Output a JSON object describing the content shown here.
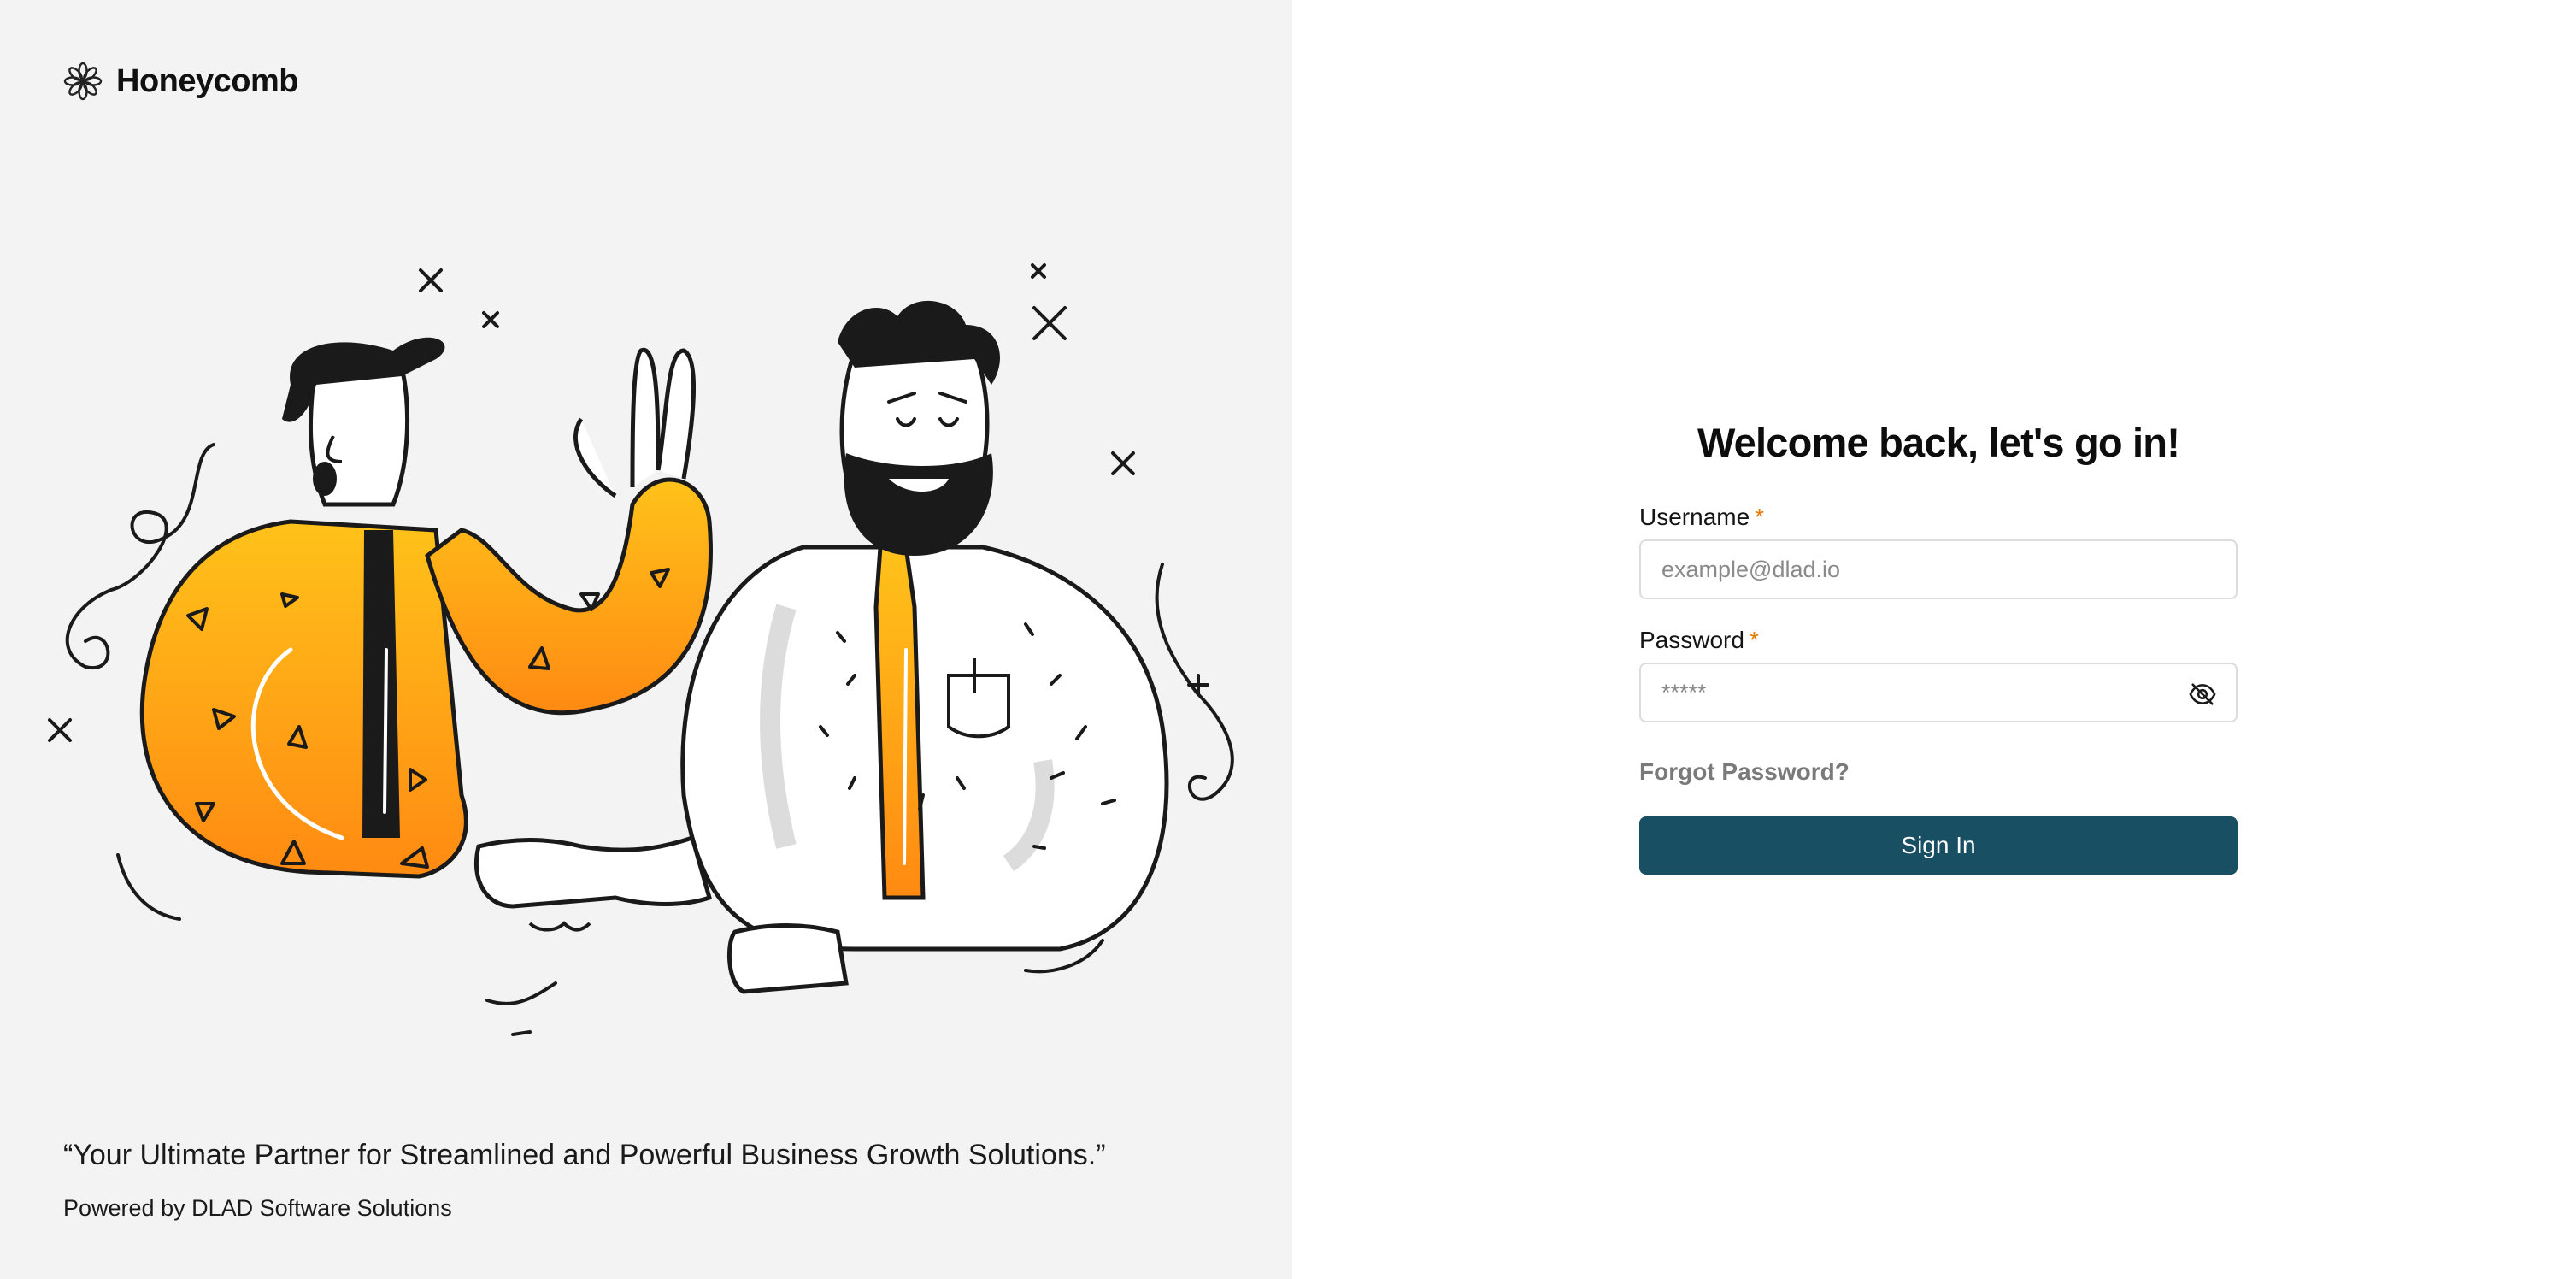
{
  "brand": {
    "name": "Honeycomb",
    "icon": "honeycomb-flower-icon"
  },
  "illustration": {
    "icon": "handshake-illustration",
    "colors": {
      "orange": "#ff9a1a",
      "orange_light": "#ffc21a",
      "ink": "#1a1a1a"
    }
  },
  "tagline": "“Your Ultimate Partner for Streamlined and Powerful Business Growth Solutions.”",
  "powered_by": "Powered by DLAD Software Solutions",
  "login": {
    "title": "Welcome back, let's go in!",
    "username": {
      "label": "Username",
      "required_mark": "*",
      "placeholder": "example@dlad.io",
      "value": ""
    },
    "password": {
      "label": "Password",
      "required_mark": "*",
      "placeholder": "*****",
      "value": "",
      "toggle_icon": "eye-off-icon"
    },
    "forgot_label": "Forgot Password?",
    "submit_label": "Sign In"
  },
  "colors": {
    "left_bg": "#f3f3f3",
    "button_bg": "#184f63",
    "required": "#e07b00"
  }
}
